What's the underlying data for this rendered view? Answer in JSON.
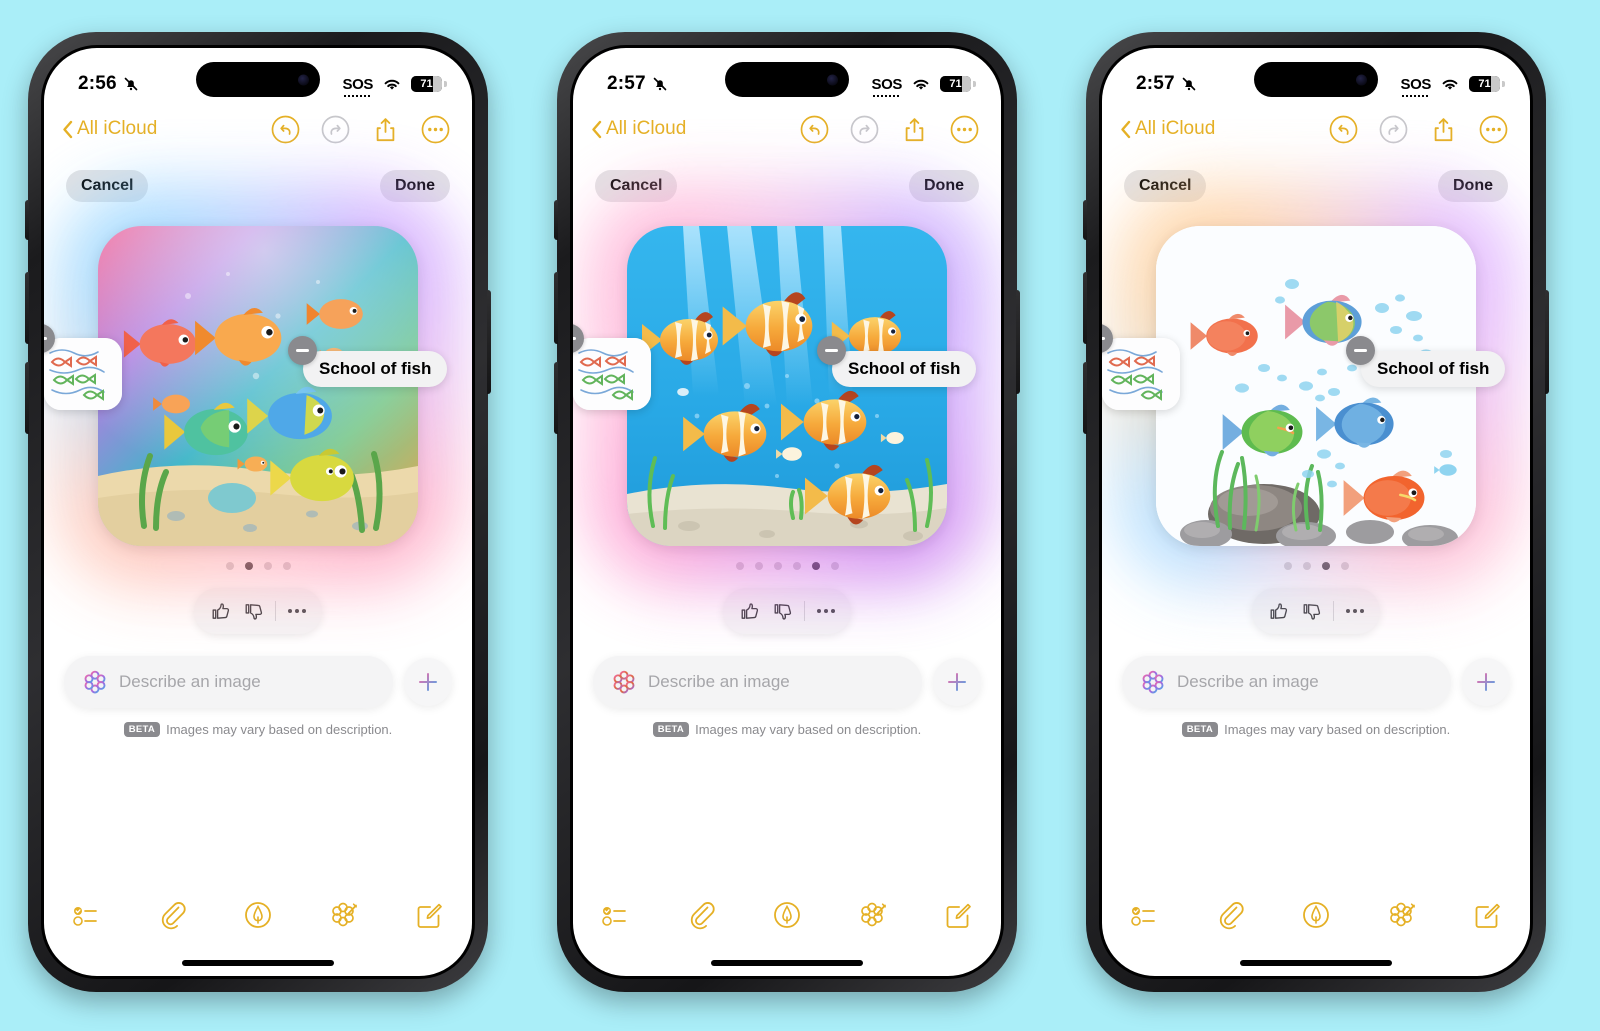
{
  "background_color": "#aaeef8",
  "accent_color": "#e5b025",
  "phones": [
    {
      "id": "phone-1",
      "status": {
        "time": "2:56",
        "silent_icon": "bell-slash-icon",
        "sos": "SOS",
        "wifi_icon": "wifi-icon",
        "battery": "71"
      },
      "nav": {
        "back_label": "All iCloud",
        "back_icon": "chevron-left-icon",
        "undo_icon": "undo-icon",
        "redo_icon": "redo-icon",
        "share_icon": "share-icon",
        "more_icon": "more-circle-icon"
      },
      "sheet": {
        "cancel_label": "Cancel",
        "done_label": "Done",
        "sketch_chip": {
          "name": "sketch-thumbnail",
          "remove_icon": "minus-icon"
        },
        "text_chip": {
          "label": "School of fish",
          "remove_icon": "minus-icon"
        },
        "image_style": "animation",
        "image_alt": "Cartoon school of colorful fish in a sunlit aquarium with sand and seaweed",
        "page_dots": {
          "count": 4,
          "active": 1
        },
        "feedback": {
          "thumbs_up_icon": "thumbs-up-icon",
          "thumbs_down_icon": "thumbs-down-icon",
          "more_icon": "ellipsis-icon"
        },
        "prompt": {
          "icon": "image-playground-icon",
          "placeholder": "Describe an image",
          "value": "",
          "add_icon": "plus-icon"
        },
        "beta_tag": "BETA",
        "beta_note": "Images may vary based on description."
      },
      "toolbar": [
        {
          "name": "checklist-icon"
        },
        {
          "name": "paperclip-icon"
        },
        {
          "name": "markup-pen-icon"
        },
        {
          "name": "image-playground-wand-icon"
        },
        {
          "name": "compose-icon"
        }
      ]
    },
    {
      "id": "phone-2",
      "status": {
        "time": "2:57",
        "silent_icon": "bell-slash-icon",
        "sos": "SOS",
        "wifi_icon": "wifi-icon",
        "battery": "71"
      },
      "nav": {
        "back_label": "All iCloud",
        "back_icon": "chevron-left-icon",
        "undo_icon": "undo-icon",
        "redo_icon": "redo-icon",
        "share_icon": "share-icon",
        "more_icon": "more-circle-icon"
      },
      "sheet": {
        "cancel_label": "Cancel",
        "done_label": "Done",
        "sketch_chip": {
          "name": "sketch-thumbnail",
          "remove_icon": "minus-icon"
        },
        "text_chip": {
          "label": "School of fish",
          "remove_icon": "minus-icon"
        },
        "image_style": "illustration",
        "image_alt": "Illustrated school of orange and white striped fish in bright blue water",
        "page_dots": {
          "count": 6,
          "active": 4
        },
        "feedback": {
          "thumbs_up_icon": "thumbs-up-icon",
          "thumbs_down_icon": "thumbs-down-icon",
          "more_icon": "ellipsis-icon"
        },
        "prompt": {
          "icon": "image-playground-icon",
          "placeholder": "Describe an image",
          "value": "",
          "add_icon": "plus-icon"
        },
        "beta_tag": "BETA",
        "beta_note": "Images may vary based on description."
      },
      "toolbar": [
        {
          "name": "checklist-icon"
        },
        {
          "name": "paperclip-icon"
        },
        {
          "name": "markup-pen-icon"
        },
        {
          "name": "image-playground-wand-icon"
        },
        {
          "name": "compose-icon"
        }
      ]
    },
    {
      "id": "phone-3",
      "status": {
        "time": "2:57",
        "silent_icon": "bell-slash-icon",
        "sos": "SOS",
        "wifi_icon": "wifi-icon",
        "battery": "71"
      },
      "nav": {
        "back_label": "All iCloud",
        "back_icon": "chevron-left-icon",
        "undo_icon": "undo-icon",
        "redo_icon": "redo-icon",
        "share_icon": "share-icon",
        "more_icon": "more-circle-icon"
      },
      "sheet": {
        "cancel_label": "Cancel",
        "done_label": "Done",
        "sketch_chip": {
          "name": "sketch-thumbnail",
          "remove_icon": "minus-icon"
        },
        "text_chip": {
          "label": "School of fish",
          "remove_icon": "minus-icon"
        },
        "image_style": "sketch",
        "image_alt": "Colored pencil sketch of a school of fish with bubbles, seaweed and rocks on white",
        "page_dots": {
          "count": 4,
          "active": 2
        },
        "feedback": {
          "thumbs_up_icon": "thumbs-up-icon",
          "thumbs_down_icon": "thumbs-down-icon",
          "more_icon": "ellipsis-icon"
        },
        "prompt": {
          "icon": "image-playground-icon",
          "placeholder": "Describe an image",
          "value": "",
          "add_icon": "plus-icon"
        },
        "beta_tag": "BETA",
        "beta_note": "Images may vary based on description."
      },
      "toolbar": [
        {
          "name": "checklist-icon"
        },
        {
          "name": "paperclip-icon"
        },
        {
          "name": "markup-pen-icon"
        },
        {
          "name": "image-playground-wand-icon"
        },
        {
          "name": "compose-icon"
        }
      ]
    }
  ]
}
